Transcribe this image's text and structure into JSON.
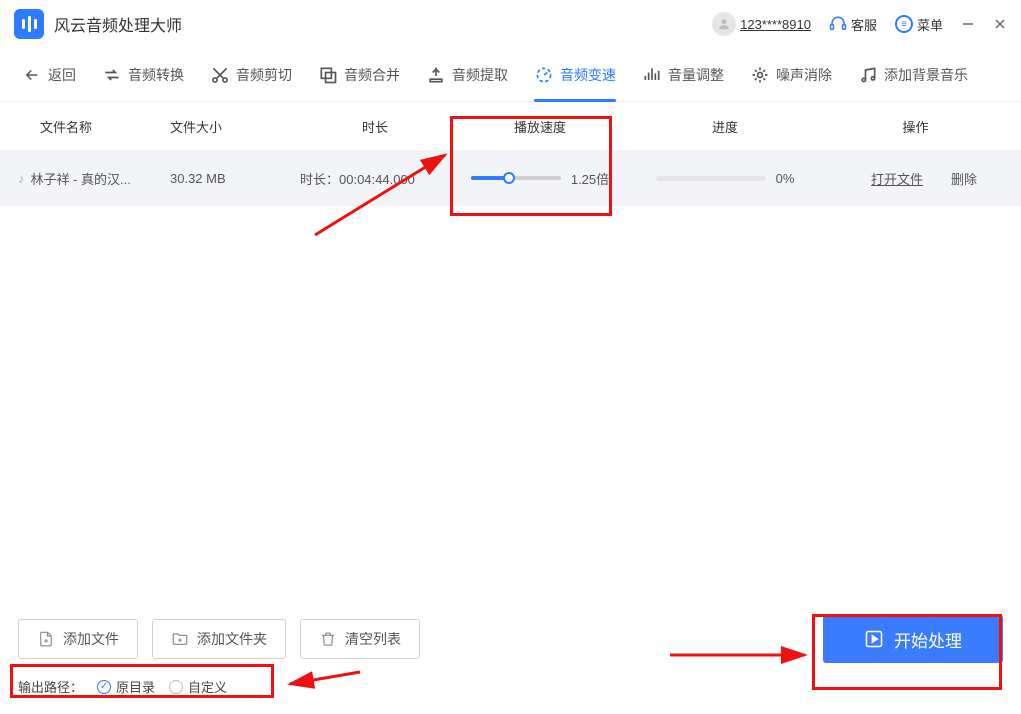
{
  "app": {
    "title": "风云音频处理大师"
  },
  "header": {
    "user_id": "123****8910",
    "support": "客服",
    "menu": "菜单"
  },
  "toolbar": {
    "back": "返回",
    "items": [
      {
        "label": "音频转换",
        "icon": "convert"
      },
      {
        "label": "音频剪切",
        "icon": "cut"
      },
      {
        "label": "音频合并",
        "icon": "merge"
      },
      {
        "label": "音频提取",
        "icon": "extract"
      },
      {
        "label": "音频变速",
        "icon": "speed",
        "active": true
      },
      {
        "label": "音量调整",
        "icon": "volume"
      },
      {
        "label": "噪声消除",
        "icon": "noise"
      },
      {
        "label": "添加背景音乐",
        "icon": "bgm"
      }
    ]
  },
  "table": {
    "headers": {
      "name": "文件名称",
      "size": "文件大小",
      "duration": "时长",
      "speed": "播放速度",
      "progress": "进度",
      "ops": "操作"
    },
    "rows": [
      {
        "name": "林子祥 - 真的汉...",
        "size": "30.32 MB",
        "duration_label": "时长：00:04:44.000",
        "speed_percent": 42,
        "speed_text": "1.25倍",
        "progress_percent": 0,
        "progress_text": "0%",
        "open": "打开文件",
        "delete": "删除"
      }
    ]
  },
  "bottom": {
    "add_file": "添加文件",
    "add_folder": "添加文件夹",
    "clear": "清空列表",
    "start": "开始处理",
    "output_label": "输出路径：",
    "radio_original": "原目录",
    "radio_custom": "自定义"
  }
}
